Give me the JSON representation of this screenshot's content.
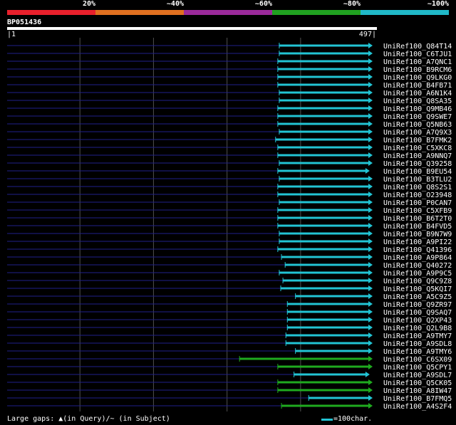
{
  "header": {
    "query_id": "BP051436",
    "start": "1",
    "end": "497",
    "identity_legend": [
      {
        "label": "20%",
        "color": "#e8202c"
      },
      {
        "label": "~40%",
        "color": "#e07020"
      },
      {
        "label": "~60%",
        "color": "#9a2a9a"
      },
      {
        "label": "~80%",
        "color": "#20a020"
      },
      {
        "label": "~100%",
        "color": "#20b8c8"
      }
    ]
  },
  "footer": {
    "gaps_text": "Large gaps: ▲(in Query)/~ (in Subject)",
    "scale_text": "=100char."
  },
  "chart_data": {
    "type": "alignment",
    "query_length": 497,
    "colors": {
      "high": "#22c4d4",
      "medium": "#1faa1f",
      "query_line": "#20208a",
      "grid": "#505050"
    },
    "hits": [
      {
        "name": "UniRef100_Q84T14",
        "start": 371,
        "end": 497,
        "identity": "high"
      },
      {
        "name": "UniRef100_C6TJU1",
        "start": 371,
        "end": 497,
        "identity": "high"
      },
      {
        "name": "UniRef100_A7QNC1",
        "start": 369,
        "end": 497,
        "identity": "high"
      },
      {
        "name": "UniRef100_B9RCM6",
        "start": 369,
        "end": 497,
        "identity": "high"
      },
      {
        "name": "UniRef100_Q9LKG0",
        "start": 369,
        "end": 497,
        "identity": "high"
      },
      {
        "name": "UniRef100_B4FB71",
        "start": 369,
        "end": 497,
        "identity": "high"
      },
      {
        "name": "UniRef100_A6N1K4",
        "start": 371,
        "end": 497,
        "identity": "high"
      },
      {
        "name": "UniRef100_Q8SA35",
        "start": 371,
        "end": 497,
        "identity": "high"
      },
      {
        "name": "UniRef100_Q9MB46",
        "start": 369,
        "end": 497,
        "identity": "high"
      },
      {
        "name": "UniRef100_Q9SWE7",
        "start": 369,
        "end": 497,
        "identity": "high"
      },
      {
        "name": "UniRef100_Q5NB63",
        "start": 369,
        "end": 497,
        "identity": "high"
      },
      {
        "name": "UniRef100_A7Q9X3",
        "start": 371,
        "end": 497,
        "identity": "high"
      },
      {
        "name": "UniRef100_B7FMK2",
        "start": 366,
        "end": 497,
        "identity": "high"
      },
      {
        "name": "UniRef100_C5XKC8",
        "start": 369,
        "end": 497,
        "identity": "high"
      },
      {
        "name": "UniRef100_A9NNQ7",
        "start": 369,
        "end": 497,
        "identity": "high"
      },
      {
        "name": "UniRef100_Q39258",
        "start": 371,
        "end": 497,
        "identity": "high"
      },
      {
        "name": "UniRef100_B9EU54",
        "start": 369,
        "end": 493,
        "identity": "high"
      },
      {
        "name": "UniRef100_B3TLU2",
        "start": 371,
        "end": 497,
        "identity": "high"
      },
      {
        "name": "UniRef100_Q8S2S1",
        "start": 369,
        "end": 497,
        "identity": "high"
      },
      {
        "name": "UniRef100_O23948",
        "start": 369,
        "end": 497,
        "identity": "high"
      },
      {
        "name": "UniRef100_P0CAN7",
        "start": 371,
        "end": 497,
        "identity": "high"
      },
      {
        "name": "UniRef100_C5XFB9",
        "start": 369,
        "end": 497,
        "identity": "high"
      },
      {
        "name": "UniRef100_B6T2T0",
        "start": 369,
        "end": 497,
        "identity": "high"
      },
      {
        "name": "UniRef100_B4FVD5",
        "start": 369,
        "end": 497,
        "identity": "high"
      },
      {
        "name": "UniRef100_B9N7W9",
        "start": 371,
        "end": 497,
        "identity": "high"
      },
      {
        "name": "UniRef100_A9PI22",
        "start": 371,
        "end": 497,
        "identity": "high"
      },
      {
        "name": "UniRef100_Q41396",
        "start": 369,
        "end": 497,
        "identity": "high"
      },
      {
        "name": "UniRef100_A9P864",
        "start": 374,
        "end": 497,
        "identity": "high"
      },
      {
        "name": "UniRef100_Q40272",
        "start": 379,
        "end": 497,
        "identity": "high"
      },
      {
        "name": "UniRef100_A9P9C5",
        "start": 371,
        "end": 497,
        "identity": "high"
      },
      {
        "name": "UniRef100_Q9C9Z8",
        "start": 376,
        "end": 497,
        "identity": "high"
      },
      {
        "name": "UniRef100_Q5KQI7",
        "start": 373,
        "end": 497,
        "identity": "high"
      },
      {
        "name": "UniRef100_A5C9Z5",
        "start": 393,
        "end": 497,
        "identity": "high"
      },
      {
        "name": "UniRef100_Q9ZR97",
        "start": 382,
        "end": 497,
        "identity": "high"
      },
      {
        "name": "UniRef100_Q9SAQ7",
        "start": 382,
        "end": 497,
        "identity": "high"
      },
      {
        "name": "UniRef100_Q2XP43",
        "start": 382,
        "end": 497,
        "identity": "high"
      },
      {
        "name": "UniRef100_Q2L9B8",
        "start": 382,
        "end": 497,
        "identity": "high"
      },
      {
        "name": "UniRef100_A9TMY7",
        "start": 380,
        "end": 497,
        "identity": "high"
      },
      {
        "name": "UniRef100_A9SDL8",
        "start": 380,
        "end": 497,
        "identity": "high"
      },
      {
        "name": "UniRef100_A9TMY6",
        "start": 393,
        "end": 497,
        "identity": "high"
      },
      {
        "name": "UniRef100_C6SX09",
        "start": 317,
        "end": 497,
        "identity": "medium"
      },
      {
        "name": "UniRef100_Q5CPY1",
        "start": 369,
        "end": 497,
        "identity": "medium"
      },
      {
        "name": "UniRef100_A9SDL7",
        "start": 391,
        "end": 493,
        "identity": "high"
      },
      {
        "name": "UniRef100_Q5CK05",
        "start": 369,
        "end": 497,
        "identity": "medium"
      },
      {
        "name": "UniRef100_A8IW47",
        "start": 369,
        "end": 497,
        "identity": "medium"
      },
      {
        "name": "UniRef100_B7FMQ5",
        "start": 411,
        "end": 497,
        "identity": "high"
      },
      {
        "name": "UniRef100_A4S2F4",
        "start": 374,
        "end": 497,
        "identity": "medium"
      }
    ]
  }
}
